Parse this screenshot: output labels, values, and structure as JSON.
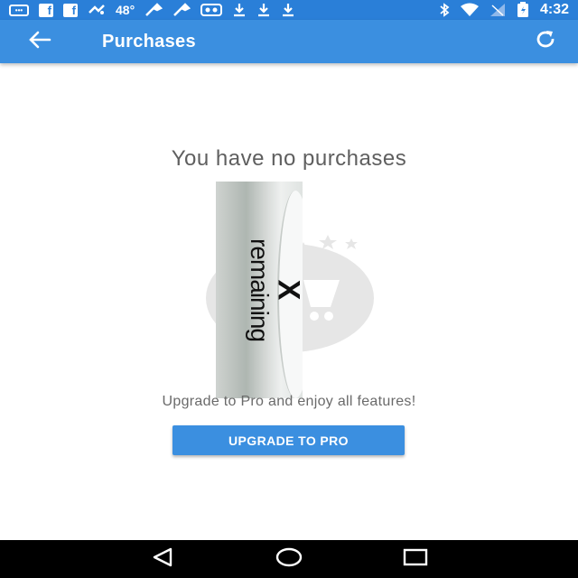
{
  "status_bar": {
    "icons_left": [
      "message-icon",
      "facebook-icon",
      "facebook-icon",
      "weather-icon",
      "wrench-icon",
      "wrench-icon",
      "photo-icon",
      "download-icon",
      "download-icon",
      "download-icon"
    ],
    "temperature": "48°",
    "icons_right": [
      "bluetooth-icon",
      "wifi-icon",
      "signal-icon",
      "battery-icon"
    ],
    "time": "4:32",
    "color": "#2a7fd8"
  },
  "app_bar": {
    "title": "Purchases",
    "back_icon": "arrow-left-icon",
    "refresh_icon": "refresh-icon",
    "color": "#3b8fe0"
  },
  "main": {
    "empty_title": "You have no purchases",
    "thumbnail_text": "remaining",
    "thumbnail_mark": "X",
    "upgrade_message": "Upgrade to Pro and enjoy all features!",
    "upgrade_button_label": "UPGRADE TO PRO"
  },
  "nav_bar": {
    "buttons": [
      "back-triangle-icon",
      "home-circle-icon",
      "recents-square-icon"
    ]
  }
}
